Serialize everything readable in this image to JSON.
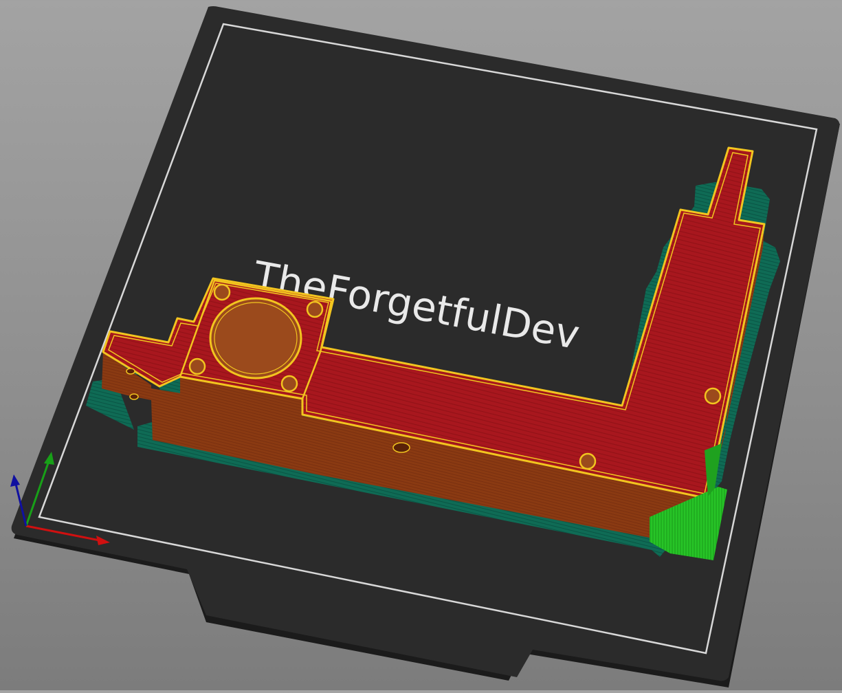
{
  "viewport": {
    "bed_text": "TheForgetfulDev"
  },
  "colors": {
    "background_top": "#a3a3a3",
    "background_bottom": "#7c7c7c",
    "bed_plate": "#2b2b2b",
    "bed_border_line": "#d8d8d8",
    "bed_text": "#e9e9e9",
    "skirt_brim": "#0f6b55",
    "perimeter_top": "#a8171e",
    "perimeter_wall": "#8a3a12",
    "outline_highlight": "#f2c51f",
    "support_material": "#27c427",
    "axis_x": "#d01010",
    "axis_y": "#18a018",
    "axis_z": "#1010a0"
  },
  "icons": {
    "axes": "xyz-axes-icon"
  }
}
